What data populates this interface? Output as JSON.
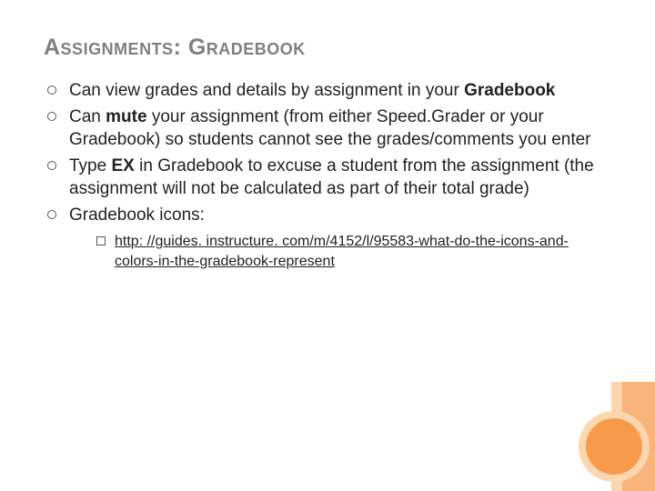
{
  "title": "Assignments: Gradebook",
  "bullets": [
    {
      "pre": "Can view grades and details by assignment in your ",
      "bold": "Gradebook",
      "post": ""
    },
    {
      "pre": "Can ",
      "bold": "mute",
      "post": " your assignment (from either Speed.Grader or your Gradebook) so students cannot see the grades/comments you enter"
    },
    {
      "pre": "Type ",
      "bold": "EX",
      "post": " in Gradebook to excuse a student from the assignment (the assignment will not be calculated as part of their total grade)"
    },
    {
      "pre": "Gradebook icons:",
      "bold": "",
      "post": ""
    }
  ],
  "sublink": {
    "text": "http: //guides. instructure. com/m/4152/l/95583-what-do-the-icons-and-colors-in-the-gradebook-represent",
    "href": "http://guides.instructure.com/m/4152/l/95583-what-do-the-icons-and-colors-in-the-gradebook-represent"
  }
}
